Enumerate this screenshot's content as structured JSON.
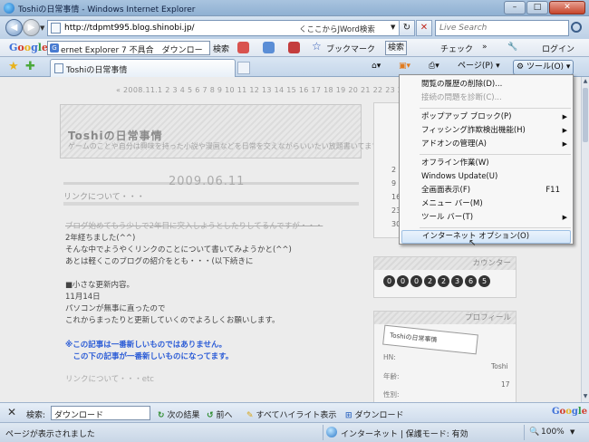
{
  "window": {
    "title": "Toshiの日常事情 - Windows Internet Explorer",
    "btn_min": "–",
    "btn_max": "□",
    "btn_close": "✕"
  },
  "address": {
    "url": "http://tdpmt995.blog.shinobi.jp/",
    "search_keyword": "くここからJWord検索",
    "live_search_placeholder": "Live Search",
    "refresh_glyph": "↻",
    "stop_glyph": "✕"
  },
  "google_bar": {
    "logo": "Google",
    "search_value": "ernet Explorer 7 不具合　ダウンロード",
    "search_btn": "検索",
    "bookmarks": "ブックマーク",
    "search2": "検索",
    "check": "チェック",
    "login": "ログイン"
  },
  "tab": {
    "title": "Toshiの日常事情"
  },
  "commands": {
    "page": "ページ(P)",
    "tools": "ツール(O)"
  },
  "page": {
    "date_bar": "« 2008.11.1 2 3 4 5 6 7 8 9 10 11 12 13 14 15 16 17 18 19 20 21 22 23 24 25",
    "blog_title": "Toshiの日常事情",
    "blog_subtitle": "ゲームのことや自分は興味を持った小説や漫画などを日常を交えながらいいたい放題書いてます",
    "post_date": "2009.06.11",
    "post_title": "リンクについて・・・",
    "lines": [
      "ブログ始めてもう少しで2年目に突入しようとしたりしてるんですが・・・",
      "2年経ちました(^^)",
      "そんな中でようやくリンクのことについて書いてみようかと(^^)",
      "あとは軽くこのブログの紹介をとも・・・(以下続きに",
      "■小さな更新内容。",
      "11月14日",
      "パソコンが無事に直ったので",
      "これからまったりと更新していくのでよろしくお願いします。",
      "※この記事は一番新しいものではありません。",
      "　この下の記事が一番新しいものになってます。",
      "リンクについて・・・etc"
    ],
    "calendar_nums": [
      "2",
      "9",
      "16",
      "23",
      "30"
    ],
    "counter_title": "カウンター",
    "counter_digits": [
      "0",
      "0",
      "0",
      "2",
      "2",
      "3",
      "6",
      "5"
    ],
    "profile_title": "プロフィール",
    "profile_banner": "Toshiの日常事情",
    "profile_hn_label": "HN:",
    "profile_hn": "Toshi",
    "profile_age_label": "年齢:",
    "profile_age": "17",
    "profile_sex_label": "性別:"
  },
  "tools_menu": {
    "items": [
      {
        "label": "閲覧の履歴の削除(D)...",
        "shortcut": "",
        "submenu": false,
        "disabled": false
      },
      {
        "label": "接続の問題を診断(C)...",
        "shortcut": "",
        "submenu": false,
        "disabled": true
      },
      {
        "label": "ポップアップ ブロック(P)",
        "shortcut": "",
        "submenu": true,
        "disabled": false
      },
      {
        "label": "フィッシング詐欺検出機能(H)",
        "shortcut": "",
        "submenu": true,
        "disabled": false
      },
      {
        "label": "アドオンの管理(A)",
        "shortcut": "",
        "submenu": true,
        "disabled": false
      },
      {
        "label": "オフライン作業(W)",
        "shortcut": "",
        "submenu": false,
        "disabled": false
      },
      {
        "label": "Windows Update(U)",
        "shortcut": "",
        "submenu": false,
        "disabled": false
      },
      {
        "label": "全画面表示(F)",
        "shortcut": "F11",
        "submenu": false,
        "disabled": false
      },
      {
        "label": "メニュー バー(M)",
        "shortcut": "",
        "submenu": false,
        "disabled": false
      },
      {
        "label": "ツール バー(T)",
        "shortcut": "",
        "submenu": true,
        "disabled": false
      },
      {
        "label": "インターネット オプション(O)",
        "shortcut": "",
        "submenu": false,
        "disabled": false
      }
    ]
  },
  "find_bar": {
    "close": "✕",
    "label": "検索:",
    "value": "ダウンロード",
    "next": "次の結果",
    "prev": "前へ",
    "highlight": "すべてハイライト表示",
    "download": "ダウンロード",
    "logo": "Google"
  },
  "status": {
    "text": "ページが表示されました",
    "zone": "インターネット | 保護モード: 有効",
    "zoom": "100%"
  }
}
